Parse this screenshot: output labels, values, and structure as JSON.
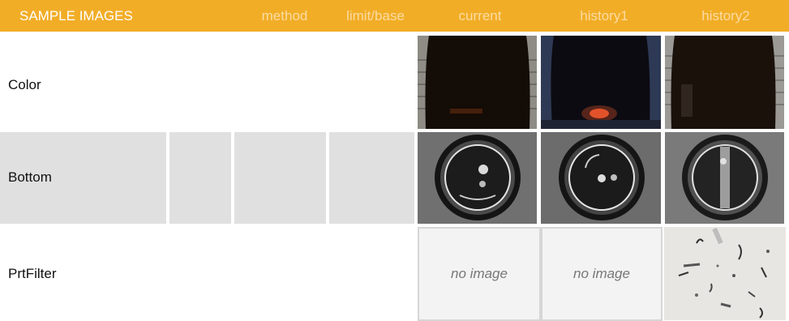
{
  "header": {
    "title": "SAMPLE IMAGES",
    "columns": [
      "method",
      "limit/base",
      "current",
      "history1",
      "history2"
    ]
  },
  "rows": [
    {
      "label": "Color"
    },
    {
      "label": "Bottom"
    },
    {
      "label": "PrtFilter"
    }
  ],
  "placeholders": {
    "no_image": "no image"
  },
  "colors": {
    "header_bg": "#f2ad27",
    "header_text": "#ffffff",
    "header_dim_text": "#fbdca1",
    "row_bg_grey": "#e0e0e0",
    "placeholder_bg": "#f3f3f3"
  }
}
